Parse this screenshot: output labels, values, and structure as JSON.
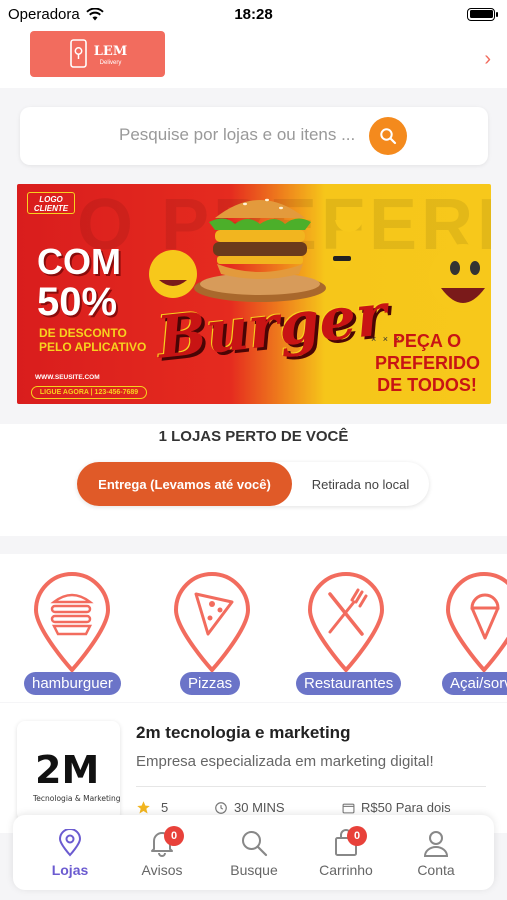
{
  "status_bar": {
    "carrier": "Operadora",
    "time": "18:28",
    "battery_level": 1.0
  },
  "header": {
    "logo_title": "LEM",
    "logo_subtitle": "Delivery",
    "accent_color": "#f26c5e",
    "forward_icon": "chevron-right-icon"
  },
  "search": {
    "placeholder": "Pesquise por lojas e ou itens ...",
    "icon": "search-icon",
    "button_color": "#f48a1d"
  },
  "banner": {
    "background_text": "O PREFERIDO",
    "logo_badge": "LOGO CLIENTE",
    "headline_line1": "COM",
    "headline_line2": "50%",
    "subline": "DE DESCONTO PELO APLICATIVO",
    "website": "WWW.SEUSITE.COM",
    "phone": "LIGUE AGORA | 123-456-7689",
    "brand_word": "Burger",
    "dots": "× × ×",
    "tagline": "PEÇA O PREFERIDO DE TODOS!"
  },
  "nearby": {
    "title": "1 LOJAS PERTO DE VOCÊ",
    "delivery_option": "Entrega (Levamos até você)",
    "pickup_option": "Retirada no local",
    "active_color": "#e05a28"
  },
  "categories": [
    {
      "label": "hamburguer",
      "icon": "hamburger-icon"
    },
    {
      "label": "Pizzas",
      "icon": "pizza-icon"
    },
    {
      "label": "Restaurantes",
      "icon": "fork-knife-icon"
    },
    {
      "label": "Açai/sorve",
      "icon": "ice-cream-icon"
    }
  ],
  "store": {
    "logo_text": "2M",
    "logo_caption": "Tecnologia & Marketing",
    "name": "2m tecnologia e marketing",
    "description": "Empresa especializada em marketing digital!",
    "rating": "5",
    "delivery_time": "30 MINS",
    "price": "R$50 Para dois"
  },
  "tabbar": {
    "active_color": "#6b5bd0",
    "tabs": [
      {
        "label": "Lojas",
        "icon": "map-pin-icon",
        "active": true
      },
      {
        "label": "Avisos",
        "icon": "bell-icon",
        "badge": "0"
      },
      {
        "label": "Busque",
        "icon": "search-icon"
      },
      {
        "label": "Carrinho",
        "icon": "bag-icon",
        "badge": "0"
      },
      {
        "label": "Conta",
        "icon": "user-icon"
      }
    ]
  }
}
